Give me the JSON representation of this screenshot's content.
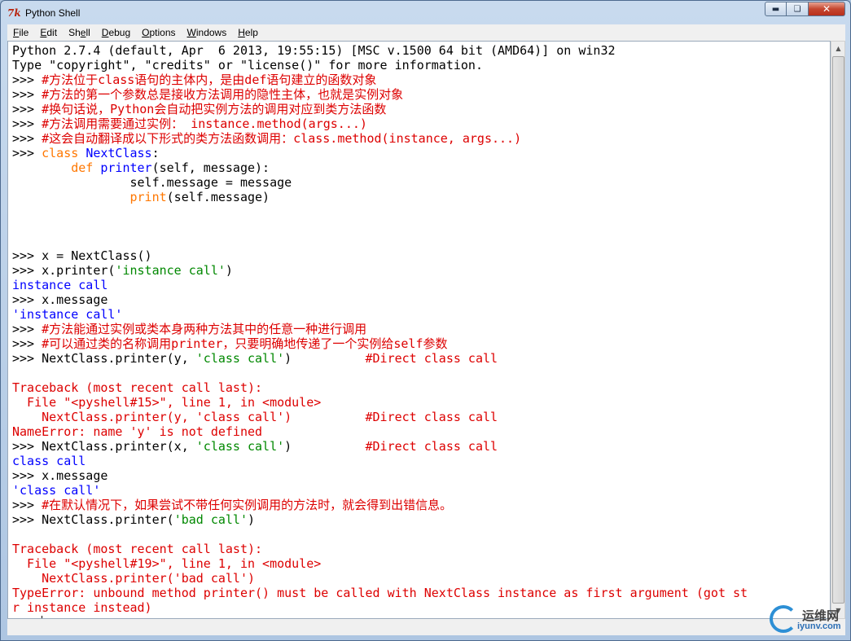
{
  "window": {
    "title": "Python Shell",
    "app_icon_glyph": "7k"
  },
  "menu": {
    "items": [
      {
        "key": "F",
        "rest": "ile"
      },
      {
        "key": "E",
        "rest": "dit"
      },
      {
        "key": "She",
        "rest": "ll",
        "underline_index": 3
      },
      {
        "key": "D",
        "rest": "ebug"
      },
      {
        "key": "O",
        "rest": "ptions"
      },
      {
        "key": "W",
        "rest": "indows"
      },
      {
        "key": "H",
        "rest": "elp"
      }
    ]
  },
  "shell": {
    "lines": [
      [
        {
          "t": "Python 2.7.4 (default, Apr  6 2013, 19:55:15) [MSC v.1500 64 bit (AMD64)] on win32",
          "c": "blk"
        }
      ],
      [
        {
          "t": "Type \"copyright\", \"credits\" or \"license()\" for more information.",
          "c": "blk"
        }
      ],
      [
        {
          "t": ">>> ",
          "c": "blk"
        },
        {
          "t": "#方法位于class语句的主体内，是由def语句建立的函数对象",
          "c": "red"
        }
      ],
      [
        {
          "t": ">>> ",
          "c": "blk"
        },
        {
          "t": "#方法的第一个参数总是接收方法调用的隐性主体，也就是实例对象",
          "c": "red"
        }
      ],
      [
        {
          "t": ">>> ",
          "c": "blk"
        },
        {
          "t": "#换句话说，Python会自动把实例方法的调用对应到类方法函数",
          "c": "red"
        }
      ],
      [
        {
          "t": ">>> ",
          "c": "blk"
        },
        {
          "t": "#方法调用需要通过实例： instance.method(args...)",
          "c": "red"
        }
      ],
      [
        {
          "t": ">>> ",
          "c": "blk"
        },
        {
          "t": "#这会自动翻译成以下形式的类方法函数调用：class.method(instance, args...)",
          "c": "red"
        }
      ],
      [
        {
          "t": ">>> ",
          "c": "blk"
        },
        {
          "t": "class ",
          "c": "orange"
        },
        {
          "t": "NextClass",
          "c": "blue"
        },
        {
          "t": ":",
          "c": "blk"
        }
      ],
      [
        {
          "t": "        ",
          "c": "blk"
        },
        {
          "t": "def ",
          "c": "orange"
        },
        {
          "t": "printer",
          "c": "blue"
        },
        {
          "t": "(self, message):",
          "c": "blk"
        }
      ],
      [
        {
          "t": "                self.message = message",
          "c": "blk"
        }
      ],
      [
        {
          "t": "                ",
          "c": "blk"
        },
        {
          "t": "print",
          "c": "orange"
        },
        {
          "t": "(self.message)",
          "c": "blk"
        }
      ],
      [
        {
          "t": "",
          "c": "blk"
        }
      ],
      [
        {
          "t": "",
          "c": "blk"
        }
      ],
      [
        {
          "t": "",
          "c": "blk"
        }
      ],
      [
        {
          "t": ">>> x = NextClass()",
          "c": "blk"
        }
      ],
      [
        {
          "t": ">>> x.printer(",
          "c": "blk"
        },
        {
          "t": "'instance call'",
          "c": "green"
        },
        {
          "t": ")",
          "c": "blk"
        }
      ],
      [
        {
          "t": "instance call",
          "c": "blue"
        }
      ],
      [
        {
          "t": ">>> x.message",
          "c": "blk"
        }
      ],
      [
        {
          "t": "'instance call'",
          "c": "blue"
        }
      ],
      [
        {
          "t": ">>> ",
          "c": "blk"
        },
        {
          "t": "#方法能通过实例或类本身两种方法其中的任意一种进行调用",
          "c": "red"
        }
      ],
      [
        {
          "t": ">>> ",
          "c": "blk"
        },
        {
          "t": "#可以通过类的名称调用printer，只要明确地传递了一个实例给self参数",
          "c": "red"
        }
      ],
      [
        {
          "t": ">>> NextClass.printer(y, ",
          "c": "blk"
        },
        {
          "t": "'class call'",
          "c": "green"
        },
        {
          "t": ")          ",
          "c": "blk"
        },
        {
          "t": "#Direct class call",
          "c": "red"
        }
      ],
      [
        {
          "t": "",
          "c": "blk"
        }
      ],
      [
        {
          "t": "Traceback (most recent call last):",
          "c": "red"
        }
      ],
      [
        {
          "t": "  File \"<pyshell#15>\", line 1, in <module>",
          "c": "red"
        }
      ],
      [
        {
          "t": "    NextClass.printer(y, 'class call')          #Direct class call",
          "c": "red"
        }
      ],
      [
        {
          "t": "NameError: name 'y' is not defined",
          "c": "red"
        }
      ],
      [
        {
          "t": ">>> NextClass.printer(x, ",
          "c": "blk"
        },
        {
          "t": "'class call'",
          "c": "green"
        },
        {
          "t": ")          ",
          "c": "blk"
        },
        {
          "t": "#Direct class call",
          "c": "red"
        }
      ],
      [
        {
          "t": "class call",
          "c": "blue"
        }
      ],
      [
        {
          "t": ">>> x.message",
          "c": "blk"
        }
      ],
      [
        {
          "t": "'class call'",
          "c": "blue"
        }
      ],
      [
        {
          "t": ">>> ",
          "c": "blk"
        },
        {
          "t": "#在默认情况下，如果尝试不带任何实例调用的方法时，就会得到出错信息。",
          "c": "red"
        }
      ],
      [
        {
          "t": ">>> NextClass.printer(",
          "c": "blk"
        },
        {
          "t": "'bad call'",
          "c": "green"
        },
        {
          "t": ")",
          "c": "blk"
        }
      ],
      [
        {
          "t": "",
          "c": "blk"
        }
      ],
      [
        {
          "t": "Traceback (most recent call last):",
          "c": "red"
        }
      ],
      [
        {
          "t": "  File \"<pyshell#19>\", line 1, in <module>",
          "c": "red"
        }
      ],
      [
        {
          "t": "    NextClass.printer('bad call')",
          "c": "red"
        }
      ],
      [
        {
          "t": "TypeError: unbound method printer() must be called with NextClass instance as first argument (got st",
          "c": "red"
        }
      ],
      [
        {
          "t": "r instance instead)",
          "c": "red"
        }
      ]
    ],
    "prompt": ">>> "
  },
  "watermark": {
    "cn": "运维网",
    "url": "iyunv.com"
  }
}
